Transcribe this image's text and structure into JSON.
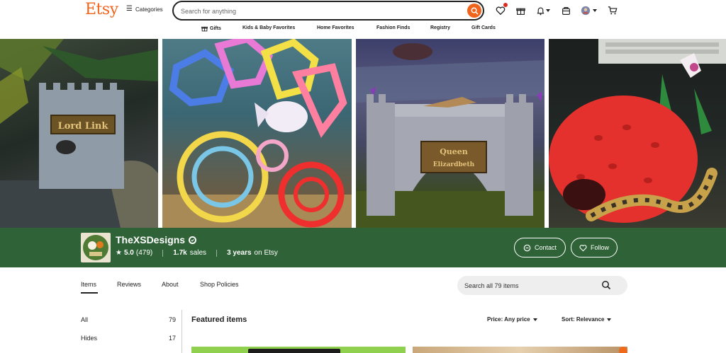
{
  "header": {
    "logo": "Etsy",
    "categories_label": "Categories",
    "search_placeholder": "Search for anything"
  },
  "nav": {
    "items": [
      {
        "label": "Gifts"
      },
      {
        "label": "Kids & Baby Favorites"
      },
      {
        "label": "Home Favorites"
      },
      {
        "label": "Fashion Finds"
      },
      {
        "label": "Registry"
      },
      {
        "label": "Gift Cards"
      }
    ]
  },
  "banner": {
    "images": [
      {
        "subject": "castle reptile hide",
        "sign_text": "Lord Link"
      },
      {
        "subject": "aquarium betta fish toys"
      },
      {
        "subject": "bridge reptile hide",
        "sign_text": "Queen Elizardbeth"
      },
      {
        "subject": "strawberry reptile hide with snake"
      }
    ]
  },
  "shop": {
    "name": "TheXSDesigns",
    "rating": "5.0",
    "review_count": "(479)",
    "sales_value": "1.7k",
    "sales_label": "sales",
    "years_value": "3 years",
    "years_label": "on Etsy",
    "contact_label": "Contact",
    "follow_label": "Follow",
    "brand_color": "#2f6337"
  },
  "tabs": [
    {
      "label": "Items",
      "active": true
    },
    {
      "label": "Reviews",
      "active": false
    },
    {
      "label": "About",
      "active": false
    },
    {
      "label": "Shop Policies",
      "active": false
    }
  ],
  "shop_search": {
    "placeholder": "Search all 79 items"
  },
  "sidebar": {
    "sections": [
      {
        "label": "All",
        "count": "79"
      },
      {
        "label": "Hides",
        "count": "17"
      }
    ]
  },
  "main": {
    "heading": "Featured items",
    "price_filter": "Price: Any price",
    "sort": "Sort: Relevance"
  },
  "icons": {
    "header": [
      "menu-icon",
      "search-icon",
      "heart-icon",
      "gift-icon",
      "bell-icon",
      "registry-icon",
      "avatar-icon",
      "cart-icon"
    ]
  }
}
